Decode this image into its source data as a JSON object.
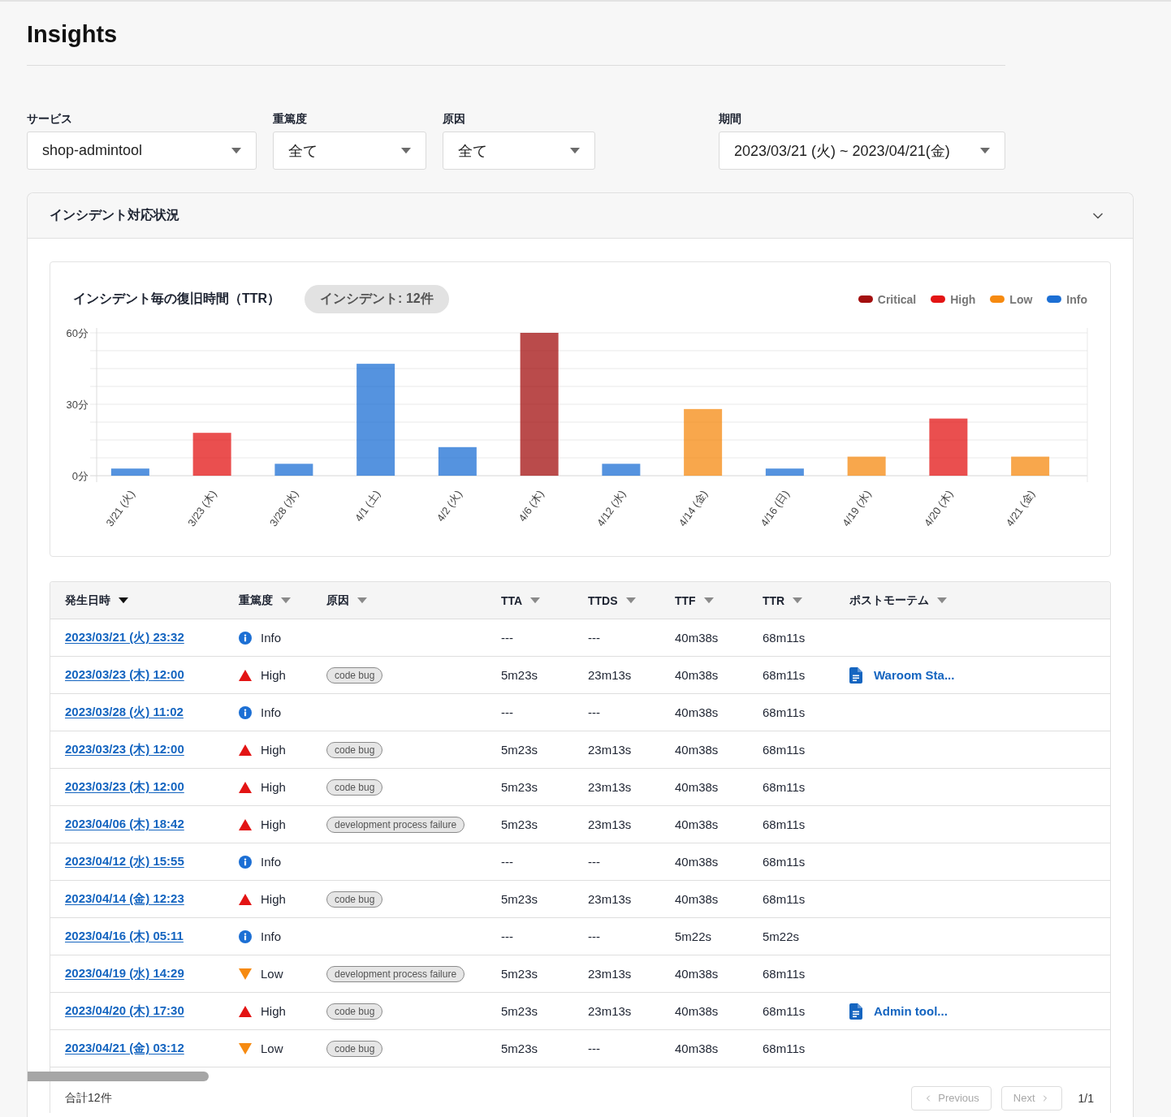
{
  "page_title": "Insights",
  "filters": [
    {
      "label": "サービス",
      "value": "shop-admintool"
    },
    {
      "label": "重篤度",
      "value": "全て"
    },
    {
      "label": "原因",
      "value": "全て"
    },
    {
      "label": "期間",
      "value": "2023/03/21 (火) ~ 2023/04/21(金)"
    }
  ],
  "panel": {
    "title": "インシデント対応状況",
    "expanded": true,
    "chart": {
      "badge": "インシデント: 12件",
      "chart_data": {
        "type": "bar",
        "title": "インシデント毎の復旧時間（TTR）",
        "categories": [
          "3/21 (火)",
          "3/23 (木)",
          "3/28 (水)",
          "4/1 (土)",
          "4/2 (火)",
          "4/6 (木)",
          "4/12 (水)",
          "4/14 (金)",
          "4/16 (日)",
          "4/19 (水)",
          "4/20 (木)",
          "4/21 (金)"
        ],
        "series": [
          {
            "name": "Critical",
            "color": "#a30f0f",
            "values": [
              null,
              null,
              null,
              null,
              null,
              60,
              null,
              null,
              null,
              null,
              null,
              null
            ]
          },
          {
            "name": "High",
            "color": "#e31414",
            "values": [
              null,
              18,
              null,
              null,
              null,
              null,
              null,
              null,
              null,
              null,
              24,
              null
            ]
          },
          {
            "name": "Low",
            "color": "#f68a10",
            "values": [
              null,
              null,
              null,
              null,
              null,
              null,
              null,
              28,
              null,
              8,
              null,
              8
            ]
          },
          {
            "name": "Info",
            "color": "#1c6fd4",
            "values": [
              3,
              null,
              5,
              47,
              12,
              null,
              5,
              null,
              3,
              null,
              null,
              null
            ]
          }
        ],
        "ylim": [
          0,
          60
        ],
        "yticks": [
          {
            "value": 0,
            "label": "0分"
          },
          {
            "value": 30,
            "label": "30分"
          },
          {
            "value": 60,
            "label": "60分"
          }
        ],
        "stacked": true
      }
    },
    "table": {
      "columns": [
        {
          "label": "発生日時",
          "sorted": true
        },
        {
          "label": "重篤度",
          "sorted": false
        },
        {
          "label": "原因",
          "sorted": false
        },
        {
          "label": "TTA",
          "sorted": false
        },
        {
          "label": "TTDS",
          "sorted": false
        },
        {
          "label": "TTF",
          "sorted": false
        },
        {
          "label": "TTR",
          "sorted": false
        },
        {
          "label": "ポストモーテム",
          "sorted": false
        }
      ],
      "rows": [
        {
          "occurred": "2023/03/21 (火) 23:32",
          "severity": {
            "kind": "info",
            "label": "Info"
          },
          "tta": "---",
          "ttds": "---",
          "ttf": "40m38s",
          "ttr": "68m11s"
        },
        {
          "occurred": "2023/03/23 (木) 12:00",
          "severity": {
            "kind": "high",
            "label": "High"
          },
          "cause": "code bug",
          "tta": "5m23s",
          "ttds": "23m13s",
          "ttf": "40m38s",
          "ttr": "68m11s",
          "postmortem": "Waroom Sta..."
        },
        {
          "occurred": "2023/03/28 (火) 11:02",
          "severity": {
            "kind": "info",
            "label": "Info"
          },
          "tta": "---",
          "ttds": "---",
          "ttf": "40m38s",
          "ttr": "68m11s"
        },
        {
          "occurred": "2023/03/23 (木) 12:00",
          "severity": {
            "kind": "high",
            "label": "High"
          },
          "cause": "code bug",
          "tta": "5m23s",
          "ttds": "23m13s",
          "ttf": "40m38s",
          "ttr": "68m11s"
        },
        {
          "occurred": "2023/03/23 (木) 12:00",
          "severity": {
            "kind": "high",
            "label": "High"
          },
          "cause": "code bug",
          "tta": "5m23s",
          "ttds": "23m13s",
          "ttf": "40m38s",
          "ttr": "68m11s"
        },
        {
          "occurred": "2023/04/06 (木) 18:42",
          "severity": {
            "kind": "high",
            "label": "High"
          },
          "cause": "development process failure",
          "tta": "5m23s",
          "ttds": "23m13s",
          "ttf": "40m38s",
          "ttr": "68m11s"
        },
        {
          "occurred": "2023/04/12 (水) 15:55",
          "severity": {
            "kind": "info",
            "label": "Info"
          },
          "tta": "---",
          "ttds": "---",
          "ttf": "40m38s",
          "ttr": "68m11s"
        },
        {
          "occurred": "2023/04/14 (金) 12:23",
          "severity": {
            "kind": "high",
            "label": "High"
          },
          "cause": "code bug",
          "tta": "5m23s",
          "ttds": "23m13s",
          "ttf": "40m38s",
          "ttr": "68m11s"
        },
        {
          "occurred": "2023/04/16 (木) 05:11",
          "severity": {
            "kind": "info",
            "label": "Info"
          },
          "tta": "---",
          "ttds": "---",
          "ttf": "5m22s",
          "ttr": "5m22s"
        },
        {
          "occurred": "2023/04/19 (水) 14:29",
          "severity": {
            "kind": "low",
            "label": "Low"
          },
          "cause": "development process failure",
          "tta": "5m23s",
          "ttds": "23m13s",
          "ttf": "40m38s",
          "ttr": "68m11s"
        },
        {
          "occurred": "2023/04/20 (木) 17:30",
          "severity": {
            "kind": "high",
            "label": "High"
          },
          "cause": "code bug",
          "tta": "5m23s",
          "ttds": "23m13s",
          "ttf": "40m38s",
          "ttr": "68m11s",
          "postmortem": "Admin tool..."
        },
        {
          "occurred": "2023/04/21 (金) 03:12",
          "severity": {
            "kind": "low",
            "label": "Low"
          },
          "cause": "code bug",
          "tta": "5m23s",
          "ttds": "---",
          "ttf": "40m38s",
          "ttr": "68m11s"
        }
      ],
      "footer": {
        "total": "合計12件",
        "previous": {
          "label": "Previous",
          "disabled": true
        },
        "next": {
          "label": "Next",
          "disabled": true
        },
        "page": "1/1"
      }
    }
  }
}
